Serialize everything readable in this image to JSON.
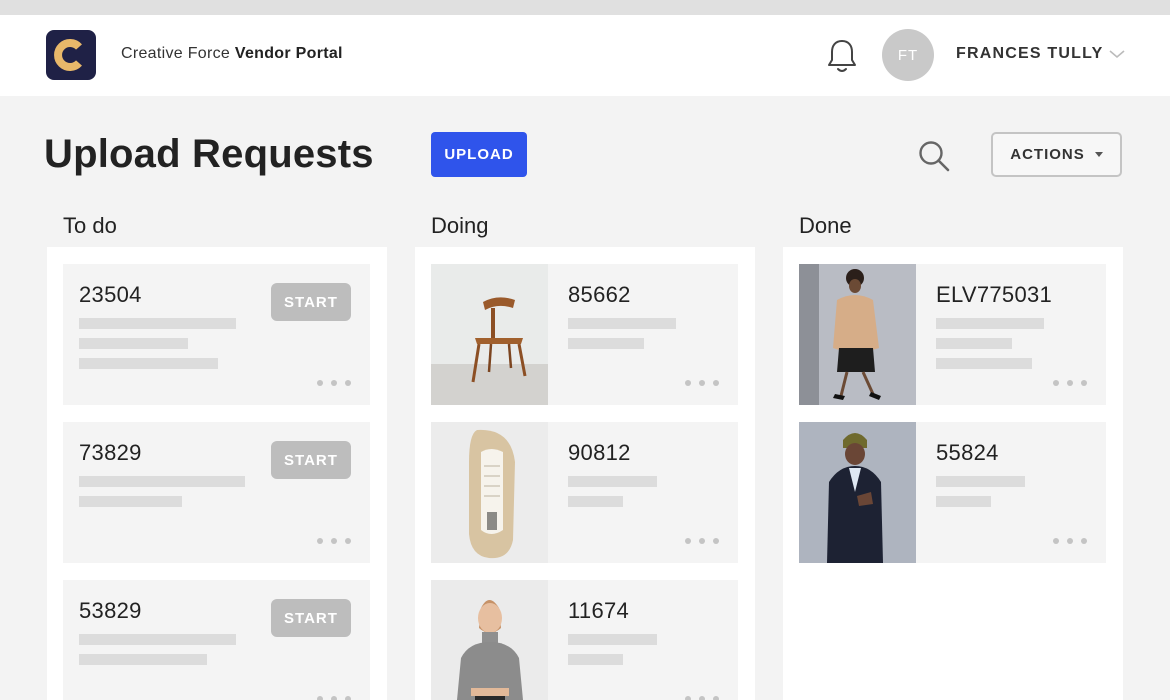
{
  "header": {
    "brand_prefix": "Creative Force",
    "brand_suffix": "Vendor Portal",
    "user_initials": "FT",
    "user_name": "FRANCES TULLY"
  },
  "page": {
    "title": "Upload Requests",
    "upload_label": "UPLOAD",
    "actions_label": "ACTIONS"
  },
  "columns": [
    {
      "title": "To do",
      "cards": [
        {
          "id": "23504",
          "action": "START"
        },
        {
          "id": "73829",
          "action": "START"
        },
        {
          "id": "53829",
          "action": "START"
        }
      ]
    },
    {
      "title": "Doing",
      "cards": [
        {
          "id": "85662",
          "thumbnail": "chair-photo"
        },
        {
          "id": "90812",
          "thumbnail": "sneaker-photo"
        },
        {
          "id": "11674",
          "thumbnail": "turtleneck-model-photo"
        }
      ]
    },
    {
      "title": "Done",
      "cards": [
        {
          "id": "ELV775031",
          "thumbnail": "coat-model-photo"
        },
        {
          "id": "55824",
          "thumbnail": "blazer-model-photo"
        }
      ]
    }
  ],
  "colors": {
    "primary": "#2f54eb",
    "logo_bg": "#1f2146",
    "logo_accent": "#e8b86a",
    "start_button": "#bdbdbd"
  }
}
